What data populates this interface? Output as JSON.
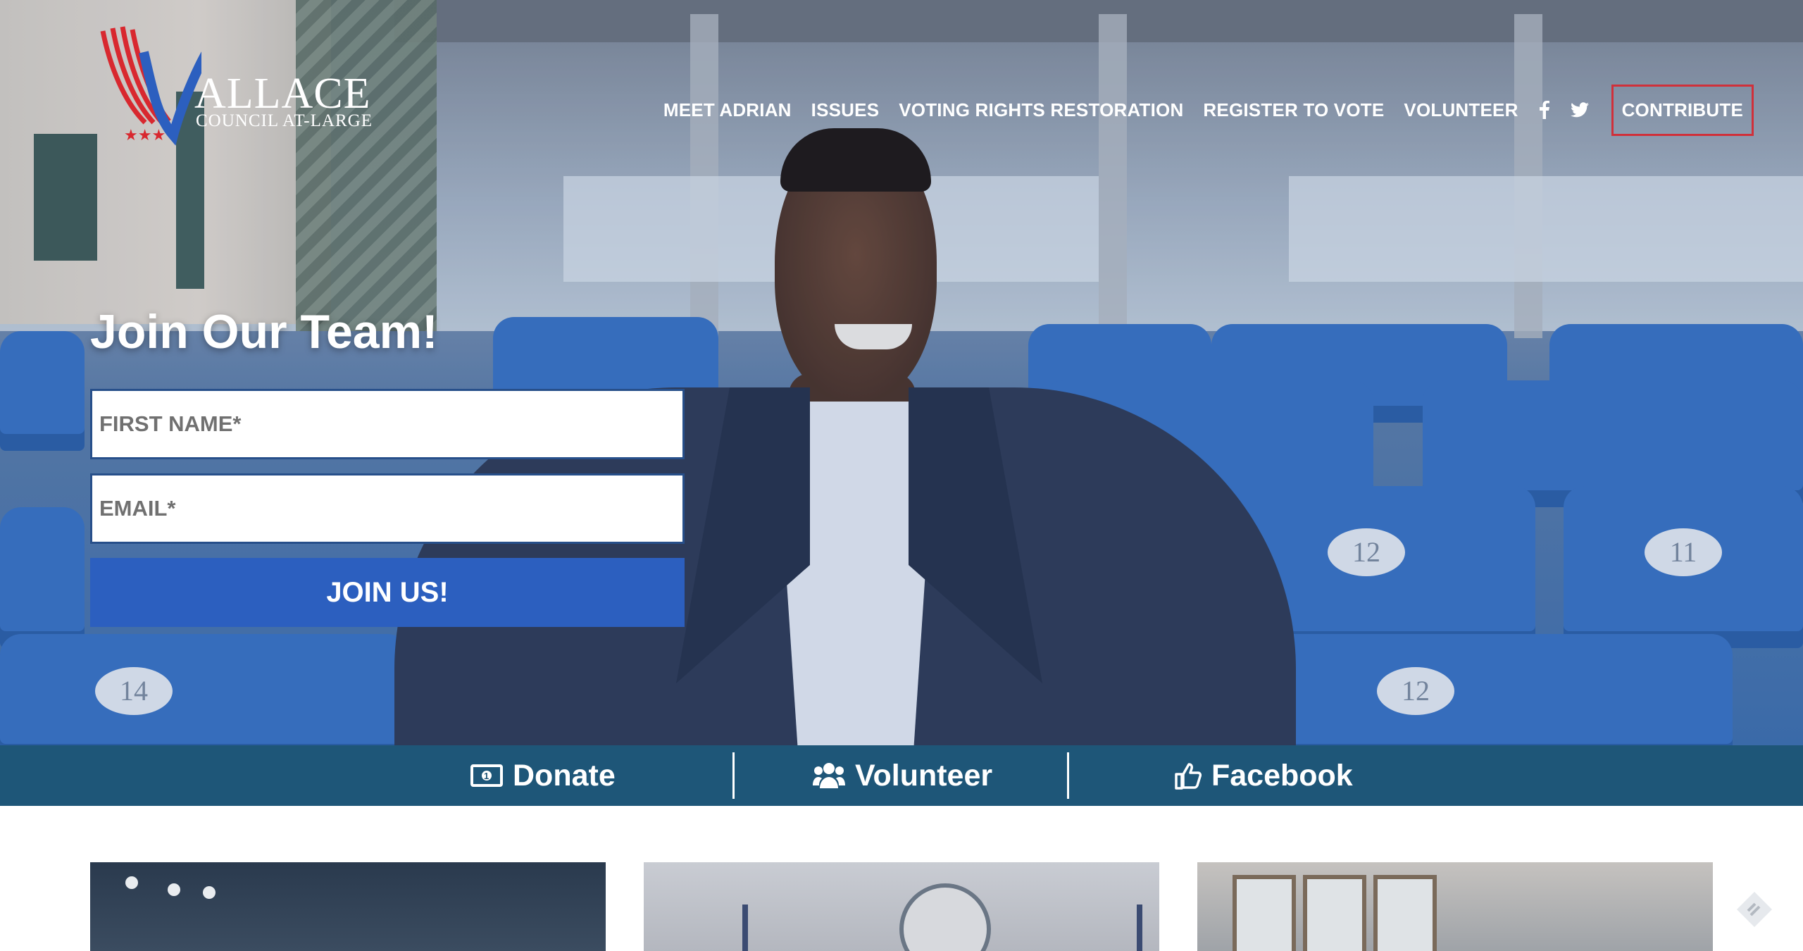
{
  "logo": {
    "wordmark": "ALLACE",
    "subtitle": "COUNCIL AT-LARGE",
    "stripe_color": "#d8282f",
    "check_color": "#2c5fbf"
  },
  "nav": {
    "items": [
      {
        "label": "MEET ADRIAN"
      },
      {
        "label": "ISSUES"
      },
      {
        "label": "VOTING RIGHTS RESTORATION"
      },
      {
        "label": "REGISTER TO VOTE"
      },
      {
        "label": "VOLUNTEER"
      }
    ],
    "social_icons": [
      "facebook-icon",
      "twitter-icon"
    ],
    "contribute_label": "CONTRIBUTE",
    "contribute_border_color": "#d0303a"
  },
  "signup": {
    "title": "Join Our Team!",
    "first_name_placeholder": "FIRST NAME*",
    "email_placeholder": "EMAIL*",
    "submit_label": "JOIN US!",
    "button_color": "#2c5fbf"
  },
  "hero": {
    "seat_numbers": [
      "14",
      "12",
      "12",
      "11"
    ]
  },
  "action_bar": {
    "background": "#1e5678",
    "items": [
      {
        "label": "Donate",
        "icon": "money-icon"
      },
      {
        "label": "Volunteer",
        "icon": "users-icon"
      },
      {
        "label": "Facebook",
        "icon": "thumbs-up-icon"
      }
    ]
  }
}
